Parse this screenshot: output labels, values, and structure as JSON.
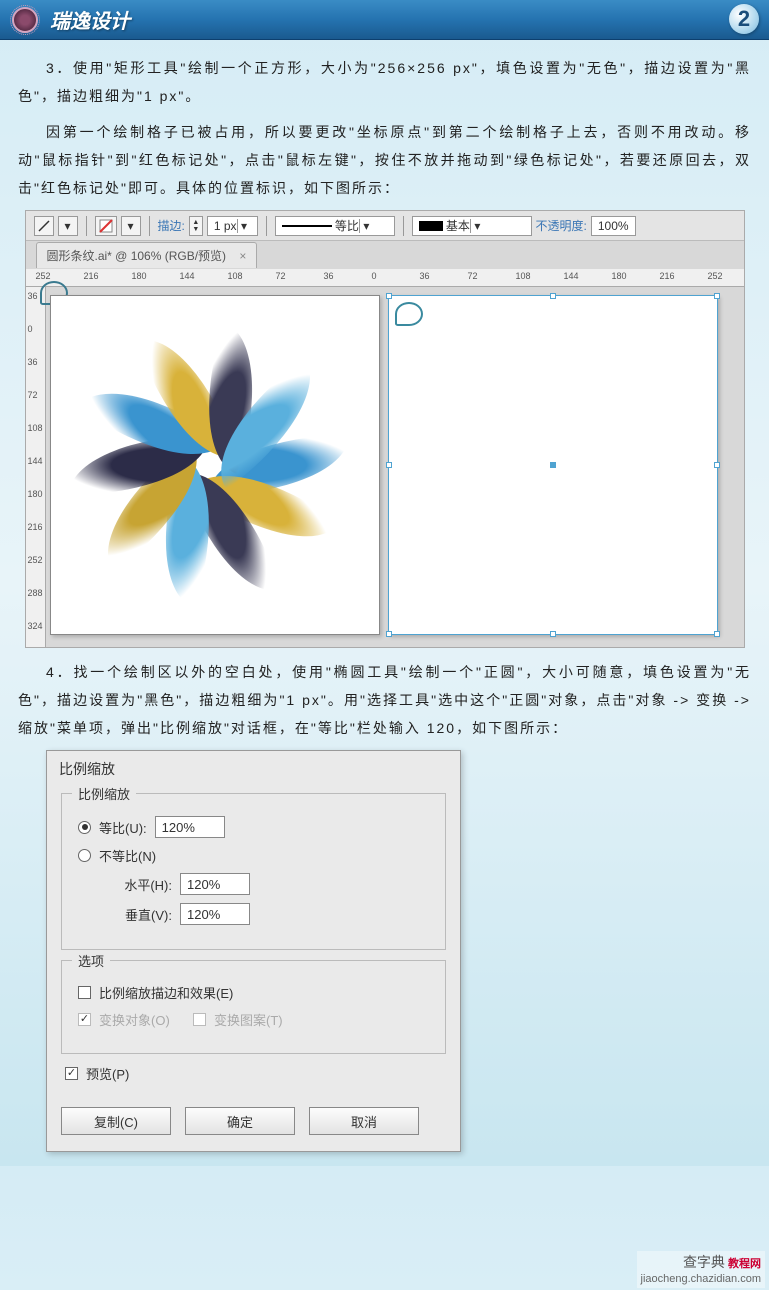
{
  "header": {
    "brand": "瑞逸设计",
    "page_number": "2"
  },
  "paragraphs": {
    "p3": "3．使用\"矩形工具\"绘制一个正方形，大小为\"256×256 px\"，填色设置为\"无色\"，描边设置为\"黑色\"，描边粗细为\"1 px\"。",
    "p3b": "因第一个绘制格子已被占用，所以要更改\"坐标原点\"到第二个绘制格子上去，否则不用改动。移动\"鼠标指针\"到\"红色标记处\"，点击\"鼠标左键\"，按住不放并拖动到\"绿色标记处\"，若要还原回去，双击\"红色标记处\"即可。具体的位置标识，如下图所示：",
    "p4": "4．找一个绘制区以外的空白处，使用\"椭圆工具\"绘制一个\"正圆\"，大小可随意，填色设置为\"无色\"，描边设置为\"黑色\"，描边粗细为\"1 px\"。用\"选择工具\"选中这个\"正圆\"对象，点击\"对象 -> 变换 -> 缩放\"菜单项，弹出\"比例缩放\"对话框，在\"等比\"栏处输入 120，如下图所示："
  },
  "ai": {
    "stroke_label": "描边:",
    "stroke_value": "1 px",
    "profile_label": "等比",
    "brush_label": "基本",
    "opacity_label": "不透明度:",
    "opacity_value": "100%",
    "tab_title": "圆形条纹.ai* @ 106% (RGB/预览)",
    "ruler_h": [
      "252",
      "216",
      "180",
      "144",
      "108",
      "72",
      "36",
      "0",
      "36",
      "72",
      "108",
      "144",
      "180",
      "216",
      "252"
    ],
    "ruler_v": [
      "36",
      "0",
      "36",
      "72",
      "108",
      "144",
      "180",
      "216",
      "252",
      "288",
      "324"
    ]
  },
  "dialog": {
    "title": "比例缩放",
    "group_scale": "比例缩放",
    "uniform": "等比(U):",
    "uniform_val": "120%",
    "nonuniform": "不等比(N)",
    "horizontal": "水平(H):",
    "horizontal_val": "120%",
    "vertical": "垂直(V):",
    "vertical_val": "120%",
    "group_options": "选项",
    "scale_strokes": "比例缩放描边和效果(E)",
    "transform_obj": "变换对象(O)",
    "transform_pat": "变换图案(T)",
    "preview": "预览(P)",
    "btn_copy": "复制(C)",
    "btn_ok": "确定",
    "btn_cancel": "取消"
  },
  "watermark": {
    "line1": "查字典",
    "line2": "教程网",
    "url": "jiaocheng.chazidian.com"
  }
}
